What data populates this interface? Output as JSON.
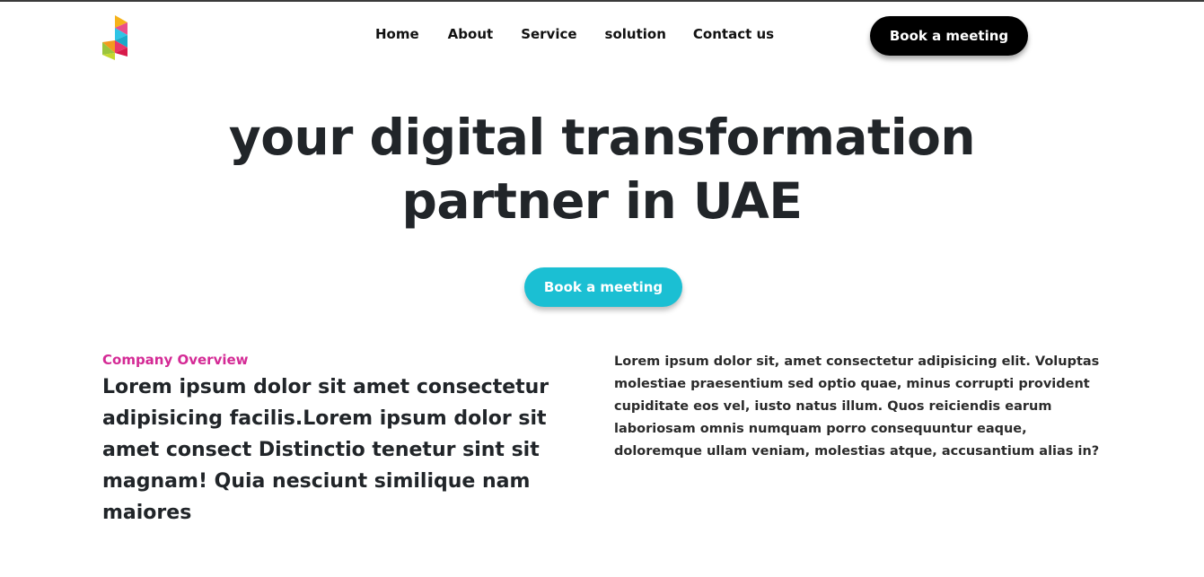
{
  "header": {
    "logo_name": "brand-logo",
    "nav": [
      {
        "label": "Home"
      },
      {
        "label": "About"
      },
      {
        "label": "Service"
      },
      {
        "label": "solution"
      },
      {
        "label": "Contact us"
      }
    ],
    "cta_label": "Book a meeting"
  },
  "hero": {
    "title_line1": "your digital transformation",
    "title_line2": "partner in UAE",
    "cta_label": "Book a meeting"
  },
  "overview": {
    "eyebrow": "Company Overview",
    "lead": "Lorem ipsum dolor sit amet consectetur adipisicing facilis.Lorem ipsum dolor sit amet consect Distinctio tenetur sint sit magnam! Quia nesciunt similique nam maiores",
    "paragraph": "Lorem ipsum dolor sit, amet consectetur adipisicing elit. Voluptas molestiae praesentium sed optio quae, minus corrupti provident cupiditate eos vel, iusto natus illum. Quos reiciendis earum laboriosam omnis numquam porro consequuntur eaque, doloremque ullam veniam, molestias atque, accusantium alias in?"
  },
  "colors": {
    "accent_cyan": "#1bbfd3",
    "accent_pink": "#d42a95",
    "dark": "#000000"
  }
}
